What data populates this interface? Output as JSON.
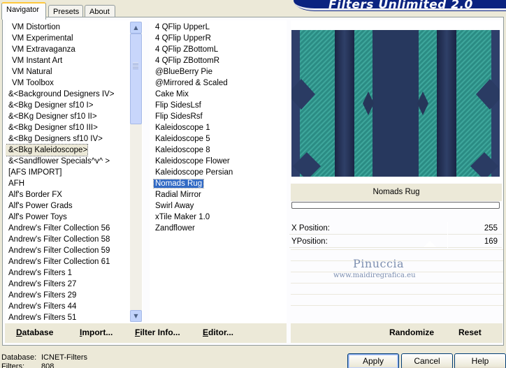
{
  "banner": {
    "title": "Filters Unlimited 2.0"
  },
  "tabs": [
    {
      "label": "Navigator",
      "active": true
    },
    {
      "label": "Presets",
      "active": false
    },
    {
      "label": "About",
      "active": false
    }
  ],
  "categories": [
    "VM Distortion",
    "VM Experimental",
    "VM Extravaganza",
    "VM Instant Art",
    "VM Natural",
    "VM Toolbox",
    "&<Background Designers IV>",
    "&<Bkg Designer sf10 I>",
    "&<BKg Designer sf10 II>",
    "&<Bkg Designer sf10 III>",
    "&<Bkg Designers sf10 IV>",
    "&<Bkg Kaleidoscope>",
    "&<Sandflower Specials^v^ >",
    "[AFS IMPORT]",
    "AFH",
    "Alf's Border FX",
    "Alf's Power Grads",
    "Alf's Power Toys",
    "Andrew's Filter Collection 56",
    "Andrew's Filter Collection 58",
    "Andrew's Filter Collection 59",
    "Andrew's Filter Collection 61",
    "Andrew's Filters 1",
    "Andrew's Filters 27",
    "Andrew's Filters 29",
    "Andrew's Filters 44",
    "Andrew's Filters 51"
  ],
  "selected_category": "&<Bkg Kaleidoscope>",
  "filters": [
    "4 QFlip UpperL",
    "4 QFlip UpperR",
    "4 QFlip ZBottomL",
    "4 QFlip ZBottomR",
    "@BlueBerry Pie",
    "@Mirrored & Scaled",
    "Cake Mix",
    "Flip SidesLsf",
    "Flip SidesRsf",
    "Kaleidoscope 1",
    "Kaleidoscope 5",
    "Kaleidoscope 8",
    "Kaleidoscope Flower",
    "Kaleidoscope Persian",
    "Nomads Rug",
    "Radial Mirror",
    "Swirl Away",
    "xTile Maker 1.0",
    "Zandflower"
  ],
  "selected_filter": "Nomads Rug",
  "preview": {
    "filter_name": "Nomads Rug"
  },
  "params": [
    {
      "label": "X Position:",
      "value": "255"
    },
    {
      "label": "YPosition:",
      "value": "169"
    }
  ],
  "watermark": {
    "line1": "Pinuccia",
    "line2": "www.maidiregrafica.eu"
  },
  "left_buttons": [
    {
      "label": "Database",
      "key": "D"
    },
    {
      "label": "Import...",
      "key": "I"
    },
    {
      "label": "Filter Info...",
      "key": "F"
    },
    {
      "label": "Editor...",
      "key": "E"
    }
  ],
  "right_buttons": [
    {
      "label": "Randomize"
    },
    {
      "label": "Reset"
    }
  ],
  "status": {
    "database_label": "Database:",
    "database_value": "ICNET-Filters",
    "filters_label": "Filters:",
    "filters_value": "808"
  },
  "dialog_buttons": {
    "apply": "Apply",
    "cancel": "Cancel",
    "help": "Help"
  },
  "colors": {
    "window_bg": "#ece9d8",
    "selection": "#316ac5",
    "banner": "#0b2380",
    "preview_teal": "#2a8a83",
    "preview_navy": "#1f2d50"
  }
}
